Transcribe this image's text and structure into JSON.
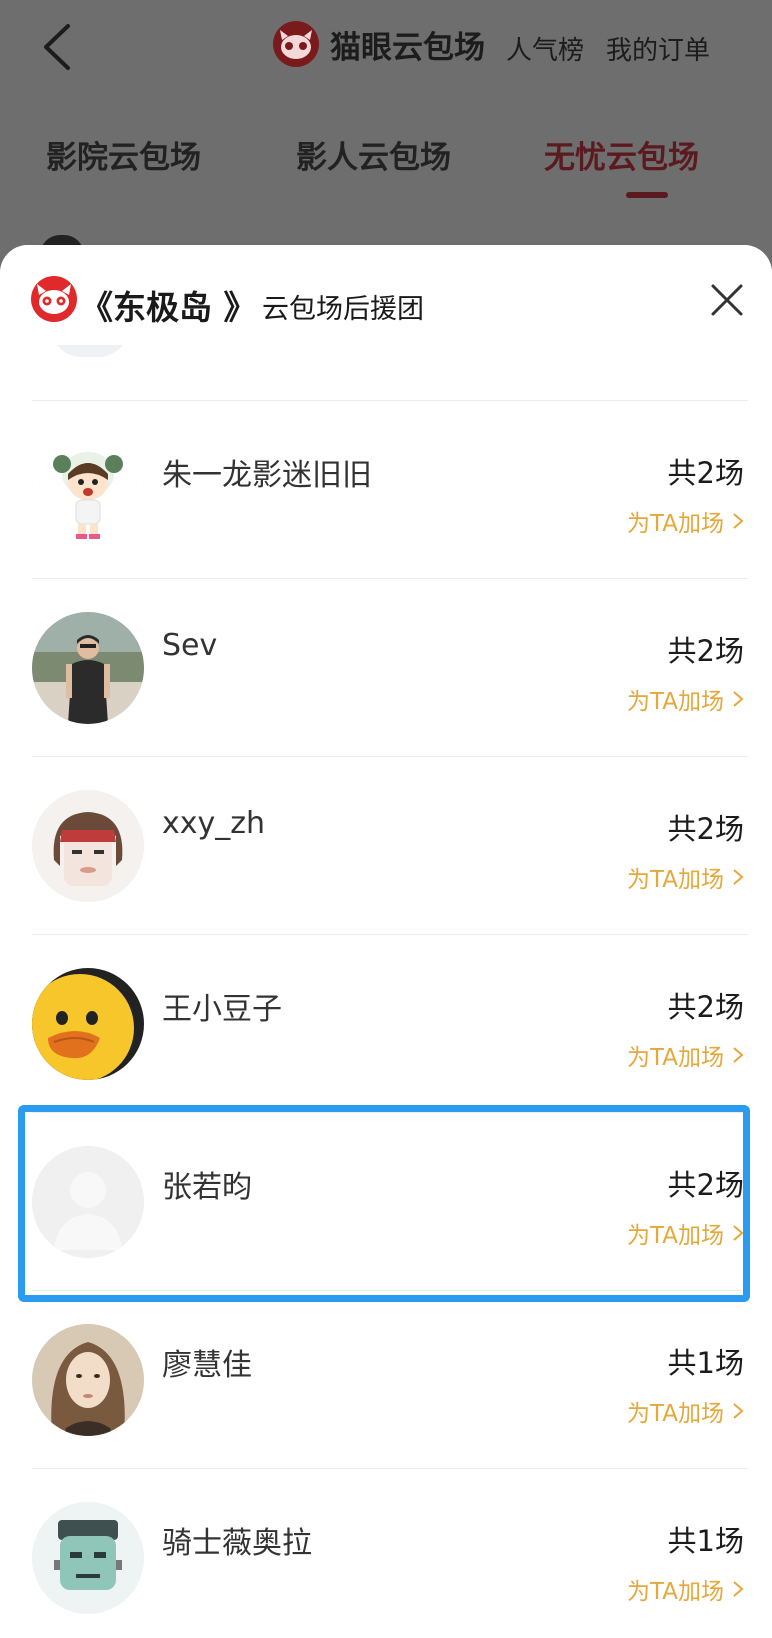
{
  "header": {
    "brand_name": "猫眼云包场",
    "links": [
      "人气榜",
      "我的订单"
    ]
  },
  "tabs": [
    {
      "label": "影院云包场",
      "active": false
    },
    {
      "label": "影人云包场",
      "active": false
    },
    {
      "label": "无忧云包场",
      "active": true
    }
  ],
  "sheet": {
    "movie_title": "《东极岛 》",
    "subtitle": "云包场后援团"
  },
  "supporters": [
    {
      "name": "朱一龙影迷旧旧",
      "count": "共2场",
      "cta": "为TA加场",
      "avatar": "cartoon-girl"
    },
    {
      "name": "Sev",
      "count": "共2场",
      "cta": "为TA加场",
      "avatar": "photo-man"
    },
    {
      "name": "xxy_zh",
      "count": "共2场",
      "cta": "为TA加场",
      "avatar": "cartoon-face"
    },
    {
      "name": "王小豆子",
      "count": "共2场",
      "cta": "为TA加场",
      "avatar": "yellow-duck"
    },
    {
      "name": "张若昀",
      "count": "共2场",
      "cta": "为TA加场",
      "avatar": "default-placeholder",
      "highlighted": true
    },
    {
      "name": "廖慧佳",
      "count": "共1场",
      "cta": "为TA加场",
      "avatar": "photo-woman"
    },
    {
      "name": "骑士薇奥拉",
      "count": "共1场",
      "cta": "为TA加场",
      "avatar": "green-monster"
    }
  ],
  "colors": {
    "accent_orange": "#e5a83a",
    "brand_red": "#e0292b",
    "active_tab": "#5b1a1f",
    "highlight_box": "#2a9bf0"
  }
}
